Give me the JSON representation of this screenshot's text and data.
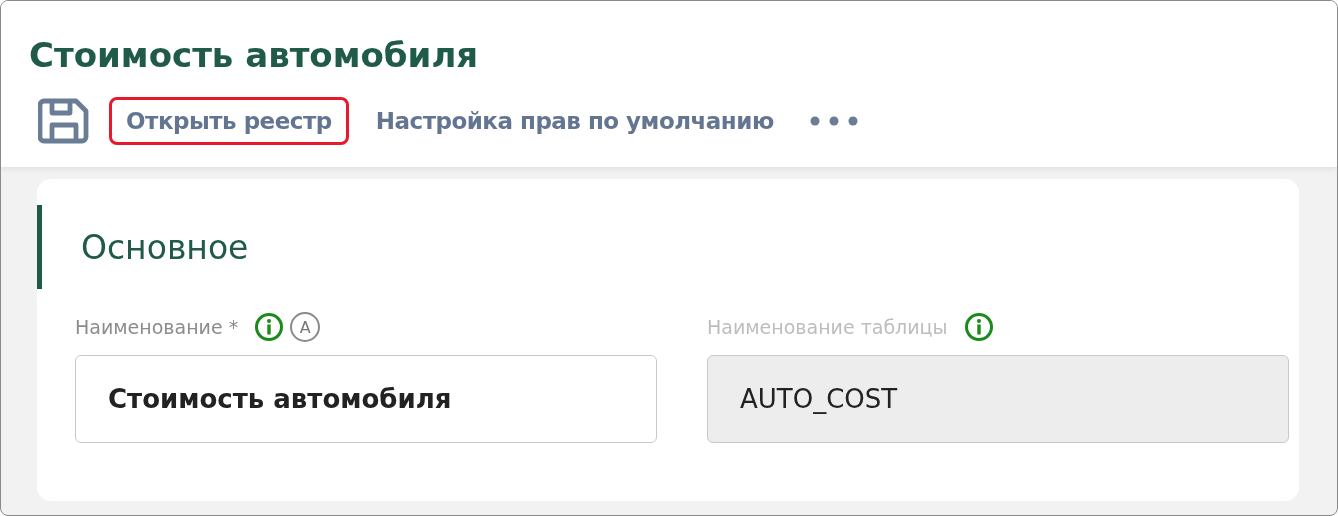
{
  "page": {
    "title": "Стоимость автомобиля"
  },
  "toolbar": [
    {
      "kind": "icon",
      "highlighted": false
    },
    {
      "kind": "text",
      "label": "Открыть реестр",
      "highlighted": true
    },
    {
      "kind": "text",
      "label": "Настройка прав по умолчанию",
      "highlighted": false
    },
    {
      "kind": "more",
      "highlighted": false
    }
  ],
  "section": {
    "title": "Основное",
    "fields": [
      {
        "label": "Наименование *",
        "value": "Стоимость автомобиля",
        "disabled": false,
        "info": true,
        "badge": "A"
      },
      {
        "label": "Наименование таблицы",
        "value": "AUTO_COST",
        "disabled": true,
        "info": true
      }
    ]
  }
}
